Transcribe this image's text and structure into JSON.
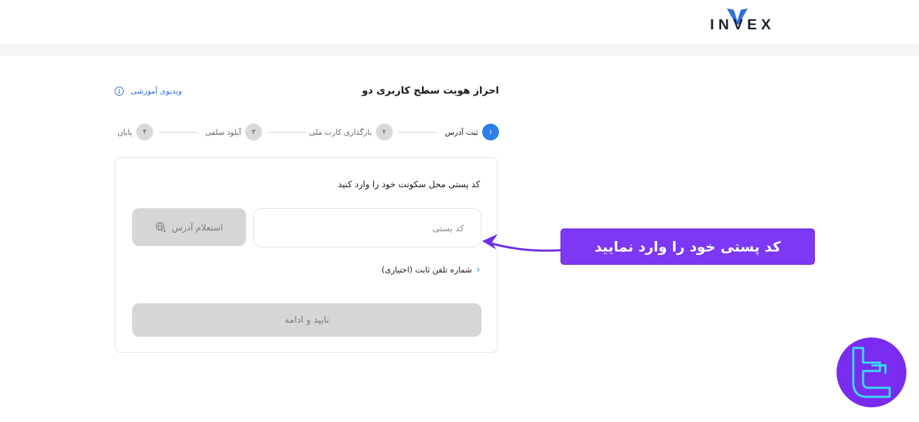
{
  "header": {
    "logo_text": "INVEX"
  },
  "page": {
    "title": "احراز هویت سطح کاربری دو",
    "video_link": "ویدیوی آموزشی",
    "info_icon": "info-icon"
  },
  "steps": [
    {
      "num": "۱",
      "label": "ثبت آدرس",
      "active": true
    },
    {
      "num": "۲",
      "label": "بارگذاری کارت ملی",
      "active": false
    },
    {
      "num": "۳",
      "label": "آپلود سلفی",
      "active": false
    },
    {
      "num": "۴",
      "label": "پایان",
      "active": false
    }
  ],
  "form": {
    "heading": "کد پستی محل سکونت خود را وارد کنید",
    "postal_placeholder": "کد پستی",
    "postal_value": "",
    "inquiry_label": "استعلام آدرس",
    "inquiry_icon": "globe-search-icon",
    "phone_toggle_label": "شماره تلفن ثابت (اختیاری)",
    "confirm_label": "تایید و ادامه"
  },
  "annotation": {
    "callout_text": "کد پستی خود را وارد نمایید"
  },
  "colors": {
    "accent": "#2f7fe8",
    "callout": "#7d38f5",
    "badge": "#7a2bf0",
    "badge_glyph": "#35e0f0"
  }
}
